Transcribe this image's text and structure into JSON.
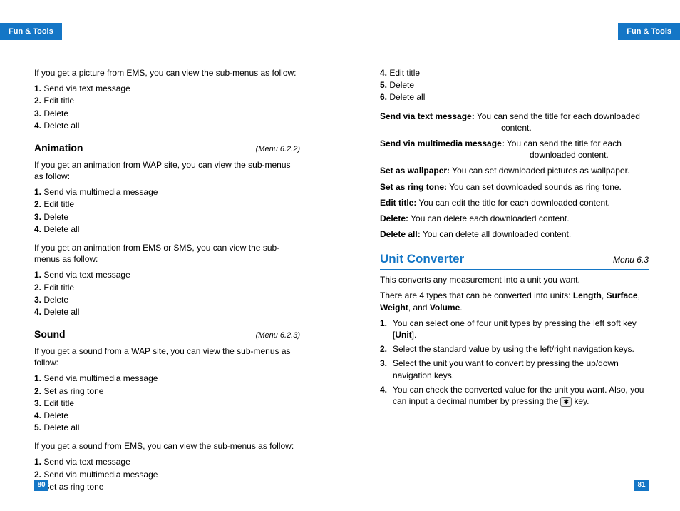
{
  "header": {
    "sectionTitle": "Fun & Tools"
  },
  "leftPage": {
    "pageNum": "80",
    "intro": "If you get a picture from EMS, you can view the sub-menus as follow:",
    "picEmsList": [
      {
        "n": "1.",
        "t": "Send via text message"
      },
      {
        "n": "2.",
        "t": "Edit title"
      },
      {
        "n": "3.",
        "t": "Delete"
      },
      {
        "n": "4.",
        "t": "Delete all"
      }
    ],
    "animation": {
      "title": "Animation",
      "menu": "(Menu 6.2.2)",
      "introWap": "If you get an animation from WAP site, you can view the sub-menus as follow:",
      "wapList": [
        {
          "n": "1.",
          "t": "Send via multimedia message"
        },
        {
          "n": "2.",
          "t": "Edit title"
        },
        {
          "n": "3.",
          "t": "Delete"
        },
        {
          "n": "4.",
          "t": "Delete all"
        }
      ],
      "introEms": "If you get an animation from EMS or SMS, you can view the sub-menus as follow:",
      "emsList": [
        {
          "n": "1.",
          "t": "Send via text message"
        },
        {
          "n": "2.",
          "t": "Edit title"
        },
        {
          "n": "3.",
          "t": "Delete"
        },
        {
          "n": "4.",
          "t": "Delete all"
        }
      ]
    },
    "sound": {
      "title": "Sound",
      "menu": "(Menu 6.2.3)",
      "introWap": "If you get a sound from a WAP site, you can view the sub-menus as follow:",
      "wapList": [
        {
          "n": "1.",
          "t": "Send via multimedia message"
        },
        {
          "n": "2.",
          "t": "Set as ring tone"
        },
        {
          "n": "3.",
          "t": "Edit title"
        },
        {
          "n": "4.",
          "t": "Delete"
        },
        {
          "n": "5.",
          "t": "Delete all"
        }
      ],
      "introEms": "If you get a sound from EMS, you can view the sub-menus as follow:",
      "emsList": [
        {
          "n": "1.",
          "t": "Send via text message"
        },
        {
          "n": "2.",
          "t": "Send via multimedia message"
        },
        {
          "n": "3.",
          "t": "Set as ring tone"
        }
      ]
    }
  },
  "rightPage": {
    "pageNum": "81",
    "topList": [
      {
        "n": "4.",
        "t": "Edit title"
      },
      {
        "n": "5.",
        "t": "Delete"
      },
      {
        "n": "6.",
        "t": "Delete all"
      }
    ],
    "defs": [
      {
        "term": "Send via text message:",
        "desc": "You can send the title for each downloaded content."
      },
      {
        "term": "Send via multimedia message:",
        "desc": "You can send the title for each downloaded content."
      },
      {
        "term": "Set as wallpaper:",
        "desc": "You can set downloaded pictures as wallpaper."
      },
      {
        "term": "Set as ring tone:",
        "desc": "You can set downloaded sounds as ring tone."
      },
      {
        "term": "Edit title:",
        "desc": "You can edit the title for each downloaded content."
      },
      {
        "term": "Delete:",
        "desc": "You can delete each downloaded content."
      },
      {
        "term": "Delete all:",
        "desc": "You can delete all downloaded content."
      }
    ],
    "unit": {
      "title": "Unit Converter",
      "menu": "Menu 6.3",
      "intro1": "This converts any measurement into a unit you want.",
      "intro2a": "There are 4 types that can be converted into units: ",
      "types": {
        "a": "Length",
        "b": "Surface",
        "c": "Weight",
        "d": "Volume"
      },
      "comma": ", ",
      "and": ", and ",
      "dot": ".",
      "steps": [
        {
          "n": "1.",
          "pre": "You can select one of four unit types by pressing the left soft key [",
          "unit": "Unit",
          "post": "]."
        },
        {
          "n": "2.",
          "t": "Select the standard value by using the left/right navigation keys."
        },
        {
          "n": "3.",
          "t": "Select the unit you want to convert by pressing the up/down navigation keys."
        },
        {
          "n": "4.",
          "pre": "You can check the converted value for the unit you want. Also, you can input a decimal number by pressing the ",
          "key": "✱",
          "post": " key."
        }
      ]
    }
  }
}
